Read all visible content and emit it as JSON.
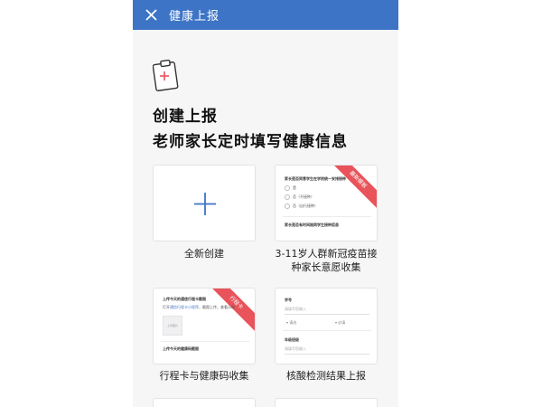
{
  "header": {
    "title": "健康上报",
    "bar_color": "#3d74c6"
  },
  "hero": {
    "line1": "创建上报",
    "line2": "老师家长定时填写健康信息"
  },
  "templates": [
    {
      "caption": "全新创建"
    },
    {
      "caption_line1": "3-11岁人群新冠疫苗接",
      "caption_line2": "种家长意愿收集",
      "ribbon": "最新模板",
      "preview": {
        "question1": "家长是否同意学生在学校统一安排接种",
        "option1": "是",
        "option2": "否（不接种）",
        "option3": "否（自行接种）",
        "question2": "家长是否有时间陪同学生接种疫苗"
      }
    },
    {
      "caption": "行程卡与健康码收集",
      "ribbon": "行程卡",
      "preview": {
        "title1": "上传今天的通信行程卡截图",
        "hint_prefix": "打开",
        "hint_link": "通信行程卡小程序",
        "hint_suffix": "，截图上传，查看示例",
        "upload_label": "上传图片",
        "title2": "上传今天的健康码截图"
      }
    },
    {
      "caption": "核酸检测结果上报",
      "preview": {
        "field1": "学号",
        "field1_placeholder": "请填写您输入",
        "select1": "请选",
        "select2": "必填",
        "field2": "年级班级",
        "field2_placeholder": "请填写您输入"
      }
    }
  ],
  "colors": {
    "accent": "#3d74c6",
    "ribbon": "#e8545a",
    "plus": "#3d74c6"
  }
}
